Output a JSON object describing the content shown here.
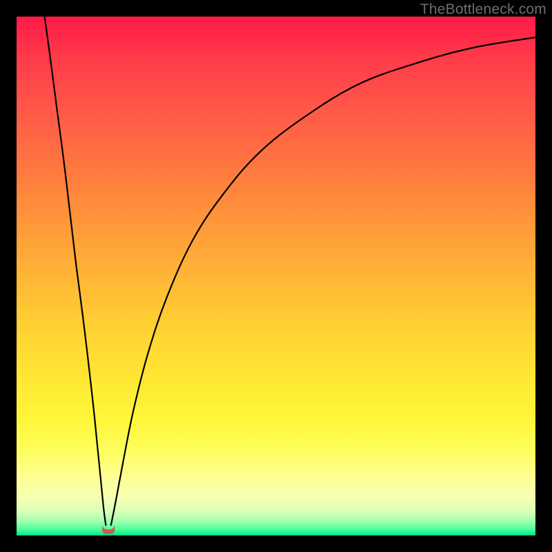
{
  "watermark": "TheBottleneck.com",
  "chart_data": {
    "type": "line",
    "title": "",
    "xlabel": "",
    "ylabel": "",
    "xlim": [
      0,
      1
    ],
    "ylim": [
      0,
      1
    ],
    "curve": {
      "minimum_x": 0.177,
      "left_branch": [
        {
          "x": 0.054,
          "y": 1.0
        },
        {
          "x": 0.065,
          "y": 0.92
        },
        {
          "x": 0.078,
          "y": 0.82
        },
        {
          "x": 0.09,
          "y": 0.73
        },
        {
          "x": 0.102,
          "y": 0.63
        },
        {
          "x": 0.115,
          "y": 0.52
        },
        {
          "x": 0.128,
          "y": 0.42
        },
        {
          "x": 0.14,
          "y": 0.32
        },
        {
          "x": 0.15,
          "y": 0.23
        },
        {
          "x": 0.158,
          "y": 0.15
        },
        {
          "x": 0.164,
          "y": 0.09
        },
        {
          "x": 0.168,
          "y": 0.05
        },
        {
          "x": 0.172,
          "y": 0.02
        }
      ],
      "right_branch": [
        {
          "x": 0.182,
          "y": 0.02
        },
        {
          "x": 0.19,
          "y": 0.06
        },
        {
          "x": 0.205,
          "y": 0.14
        },
        {
          "x": 0.225,
          "y": 0.24
        },
        {
          "x": 0.253,
          "y": 0.35
        },
        {
          "x": 0.29,
          "y": 0.46
        },
        {
          "x": 0.34,
          "y": 0.57
        },
        {
          "x": 0.4,
          "y": 0.66
        },
        {
          "x": 0.47,
          "y": 0.74
        },
        {
          "x": 0.56,
          "y": 0.81
        },
        {
          "x": 0.66,
          "y": 0.87
        },
        {
          "x": 0.77,
          "y": 0.91
        },
        {
          "x": 0.88,
          "y": 0.94
        },
        {
          "x": 1.0,
          "y": 0.96
        }
      ],
      "nub": {
        "x": 0.177,
        "y_top": 0.022,
        "y_bottom": 0.003,
        "half_width": 0.012
      }
    },
    "gradient_stops": [
      {
        "pos": 0.0,
        "color": "#ff1a47"
      },
      {
        "pos": 0.5,
        "color": "#ffb536"
      },
      {
        "pos": 0.8,
        "color": "#fff73a"
      },
      {
        "pos": 1.0,
        "color": "#00e68a"
      }
    ]
  }
}
